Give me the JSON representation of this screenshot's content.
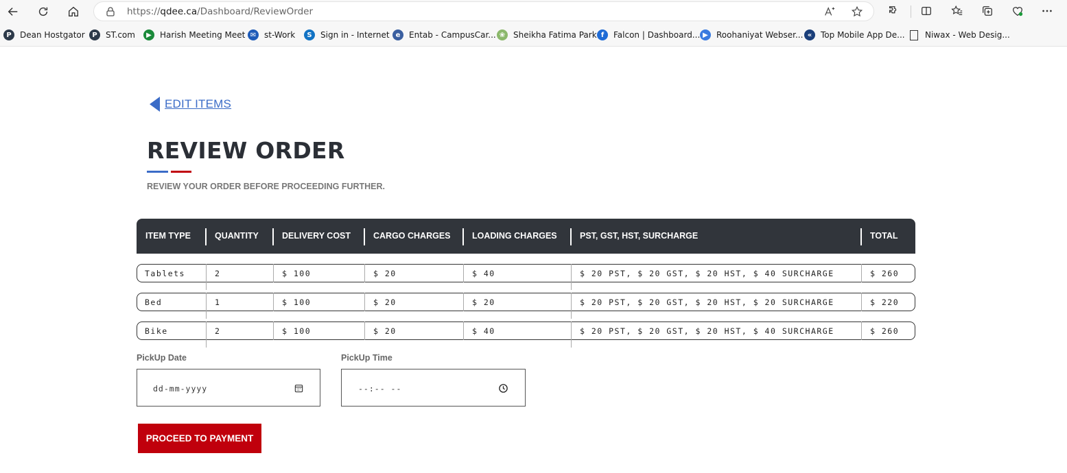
{
  "browser": {
    "url_prefix": "https://",
    "url_host": "qdee.ca",
    "url_path": "/Dashboard/ReviewOrder",
    "bookmarks": [
      {
        "label": "Dean Hostgator",
        "icon": "p-circle-icon",
        "color": "#2d3a4a",
        "glyph": "P"
      },
      {
        "label": "ST.com",
        "icon": "p-circle-icon",
        "color": "#2d3a4a",
        "glyph": "P"
      },
      {
        "label": "Harish Meeting Meet",
        "icon": "google-meet-icon",
        "color": "#1a8a3a",
        "glyph": "▶"
      },
      {
        "label": "st-Work",
        "icon": "mail-icon",
        "color": "#1e5bb8",
        "glyph": "✉"
      },
      {
        "label": "Sign in - Internet",
        "icon": "s-square-icon",
        "color": "#1273c4",
        "glyph": "S"
      },
      {
        "label": "Entab - CampusCar...",
        "icon": "entab-icon",
        "color": "#3a5fa0",
        "glyph": "e"
      },
      {
        "label": "Sheikha Fatima Park",
        "icon": "park-icon",
        "color": "#8bb86b",
        "glyph": "❀"
      },
      {
        "label": "Falcon | Dashboard...",
        "icon": "falcon-icon",
        "color": "#1e6bd6",
        "glyph": "f"
      },
      {
        "label": "Roohaniyat Webser...",
        "icon": "play-circle-icon",
        "color": "#3a7be0",
        "glyph": "▶"
      },
      {
        "label": "Top Mobile App De...",
        "icon": "arrow-logo-icon",
        "color": "#1b3f7a",
        "glyph": "«"
      },
      {
        "label": "Niwax - Web Desig...",
        "icon": "page-icon",
        "color": "#ffffff",
        "glyph": ""
      }
    ]
  },
  "page": {
    "back_link": "EDIT ITEMS",
    "title": "REVIEW ORDER",
    "subtitle": "REVIEW YOUR ORDER BEFORE PROCEEDING FURTHER.",
    "accent_blue": "#3b6cc7",
    "accent_red": "#c0000c"
  },
  "table": {
    "headers": [
      "ITEM TYPE",
      "QUANTITY",
      "DELIVERY COST",
      "CARGO CHARGES",
      "LOADING CHARGES",
      "PST, GST, HST, SURCHARGE",
      "TOTAL"
    ],
    "rows": [
      [
        "Tablets",
        "2",
        "$ 100",
        "$ 20",
        "$ 40",
        "$ 20 PST, $ 20 GST, $ 20 HST, $ 40 SURCHARGE",
        "$ 260"
      ],
      [
        "Bed",
        "1",
        "$ 100",
        "$ 20",
        "$ 20",
        "$ 20 PST, $ 20 GST, $ 20 HST, $ 20 SURCHARGE",
        "$ 220"
      ],
      [
        "Bike",
        "2",
        "$ 100",
        "$ 20",
        "$ 40",
        "$ 20 PST, $ 20 GST, $ 20 HST, $ 40 SURCHARGE",
        "$ 260"
      ]
    ]
  },
  "pickup": {
    "date_label": "PickUp Date",
    "date_placeholder": "dd-mm-yyyy",
    "time_label": "PickUp Time",
    "time_placeholder": "--:-- --"
  },
  "actions": {
    "proceed_label": "PROCEED TO PAYMENT"
  }
}
